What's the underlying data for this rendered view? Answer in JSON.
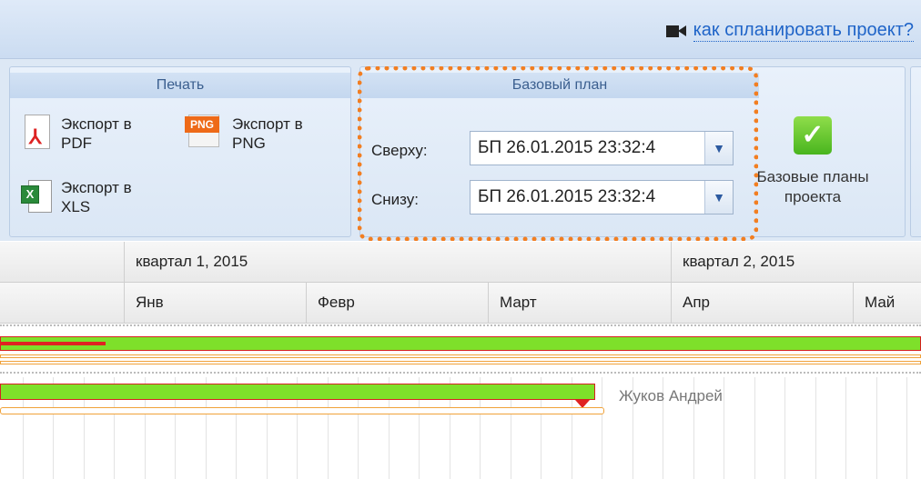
{
  "help": {
    "link": "как спланировать проект?"
  },
  "print_group": {
    "title": "Печать",
    "export_pdf": "Экспорт в PDF",
    "export_png": "Экспорт в PNG",
    "export_xls": "Экспорт в XLS",
    "png_tag": "PNG"
  },
  "baseline_group": {
    "title": "Базовый план",
    "top_label": "Сверху:",
    "top_value": "БП 26.01.2015 23:32:4",
    "bottom_label": "Снизу:",
    "bottom_value": "БП 26.01.2015 23:32:4",
    "project_baselines": "Базовые планы проекта"
  },
  "gantt": {
    "quarters": [
      "квартал 1, 2015",
      "квартал 2, 2015"
    ],
    "months": [
      "Янв",
      "Февр",
      "Март",
      "Апр",
      "Май"
    ],
    "assignee": "Жуков Андрей"
  },
  "colors": {
    "accent_orange": "#f27e21",
    "bar_green": "#7ee02a",
    "bar_red": "#e02222",
    "link_blue": "#1f64c8"
  }
}
